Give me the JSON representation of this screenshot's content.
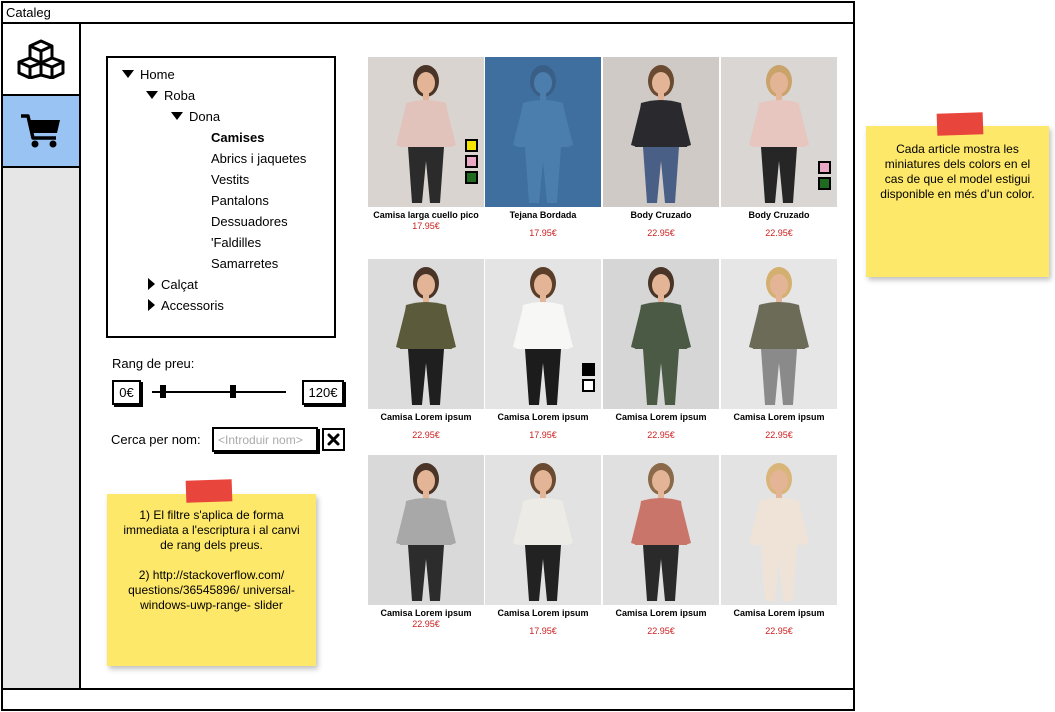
{
  "window": {
    "title": "Cataleg"
  },
  "sidebar": {
    "items": [
      {
        "icon": "cubes-icon",
        "name": "catalog"
      },
      {
        "icon": "cart-icon",
        "name": "cart",
        "active": true
      }
    ]
  },
  "tree": {
    "home": "Home",
    "roba": "Roba",
    "dona": "Dona",
    "children": [
      "Camises",
      "Abrics i jaquetes",
      "Vestits",
      "Pantalons",
      "Dessuadores",
      "'Faldilles",
      "Samarretes"
    ],
    "selected": "Camises",
    "calcat": "Calçat",
    "accessoris": "Accessoris"
  },
  "price_filter": {
    "label": "Rang de preu:",
    "min": "0€",
    "max": "120€"
  },
  "search": {
    "label": "Cerca per nom:",
    "placeholder": "<Introduir nom>"
  },
  "notes": {
    "left": {
      "line1": "1) El filtre s'aplica de forma immediata a l'escriptura i al canvi de rang dels preus.",
      "line2": "2) http://stackoverflow.com/ questions/36545896/ universal-windows-uwp-range- slider"
    },
    "right": "Cada article mostra les miniatures dels colors en el cas de que el model estigui disponible en més d'un color."
  },
  "products": [
    {
      "name": "Camisa larga cuello pico",
      "price": "17.95€",
      "swatches": [
        "#f5e400",
        "#e9a9c4",
        "#1f6b1f"
      ],
      "bg": "#d9d4d0",
      "top": "#e2c3bb",
      "bottom": "#2b2b2b",
      "skin": "#e3b596",
      "hair": "#4a3428"
    },
    {
      "name": "Tejana Bordada",
      "price": "17.95€",
      "swatches": [],
      "bg": "#3f6f9e",
      "top": "#4c7ead",
      "bottom": "#4c7ead",
      "skin": "#4c7ead",
      "hair": "#3a5f87"
    },
    {
      "name": "Body Cruzado",
      "price": "22.95€",
      "swatches": [],
      "bg": "#cfcac6",
      "top": "#2a2a2e",
      "bottom": "#4a5f86",
      "skin": "#e3b596",
      "hair": "#6b4a32"
    },
    {
      "name": "Body Cruzado",
      "price": "22.95€",
      "swatches": [
        "#e9a9c4",
        "#1f6b1f"
      ],
      "bg": "#d9d6d4",
      "top": "#e6c6bf",
      "bottom": "#262626",
      "skin": "#e3b596",
      "hair": "#c9a36a"
    },
    {
      "name": "Camisa Lorem ipsum",
      "price": "22.95€",
      "swatches": [],
      "bg": "#dcdcdc",
      "top": "#5b5b3c",
      "bottom": "#1f1f1f",
      "skin": "#e3b596",
      "hair": "#4a3428"
    },
    {
      "name": "Camisa Lorem ipsum",
      "price": "17.95€",
      "swatches": [
        "#000000",
        "#ffffff"
      ],
      "bg": "#e4e4e4",
      "top": "#f7f7f5",
      "bottom": "#1c1c1c",
      "skin": "#e3b596",
      "hair": "#5a3e2a"
    },
    {
      "name": "Camisa Lorem ipsum",
      "price": "22.95€",
      "swatches": [],
      "bg": "#d6d6d6",
      "top": "#4a5a44",
      "bottom": "#4a5a44",
      "skin": "#e3b596",
      "hair": "#4a3428"
    },
    {
      "name": "Camisa Lorem ipsum",
      "price": "22.95€",
      "swatches": [],
      "bg": "#e6e6e6",
      "top": "#6b6b58",
      "bottom": "#8a8a8a",
      "skin": "#e3b596",
      "hair": "#d4b070"
    },
    {
      "name": "Camisa Lorem ipsum",
      "price": "22.95€",
      "swatches": [],
      "bg": "#d9d9d9",
      "top": "#a8a8a8",
      "bottom": "#2c2c2c",
      "skin": "#e3b596",
      "hair": "#4a3428"
    },
    {
      "name": "Camisa Lorem ipsum",
      "price": "17.95€",
      "swatches": [],
      "bg": "#e2e2e2",
      "top": "#ecebe6",
      "bottom": "#222222",
      "skin": "#e3b596",
      "hair": "#6b4a32"
    },
    {
      "name": "Camisa Lorem ipsum",
      "price": "22.95€",
      "swatches": [],
      "bg": "#e0e0e0",
      "top": "#c9756a",
      "bottom": "#2a2a2a",
      "skin": "#e3b596",
      "hair": "#8a6a4a"
    },
    {
      "name": "Camisa Lorem ipsum",
      "price": "22.95€",
      "swatches": [],
      "bg": "#e3e3e3",
      "top": "#efe3d8",
      "bottom": "#efe3d8",
      "skin": "#e3b596",
      "hair": "#d9b57a"
    }
  ]
}
